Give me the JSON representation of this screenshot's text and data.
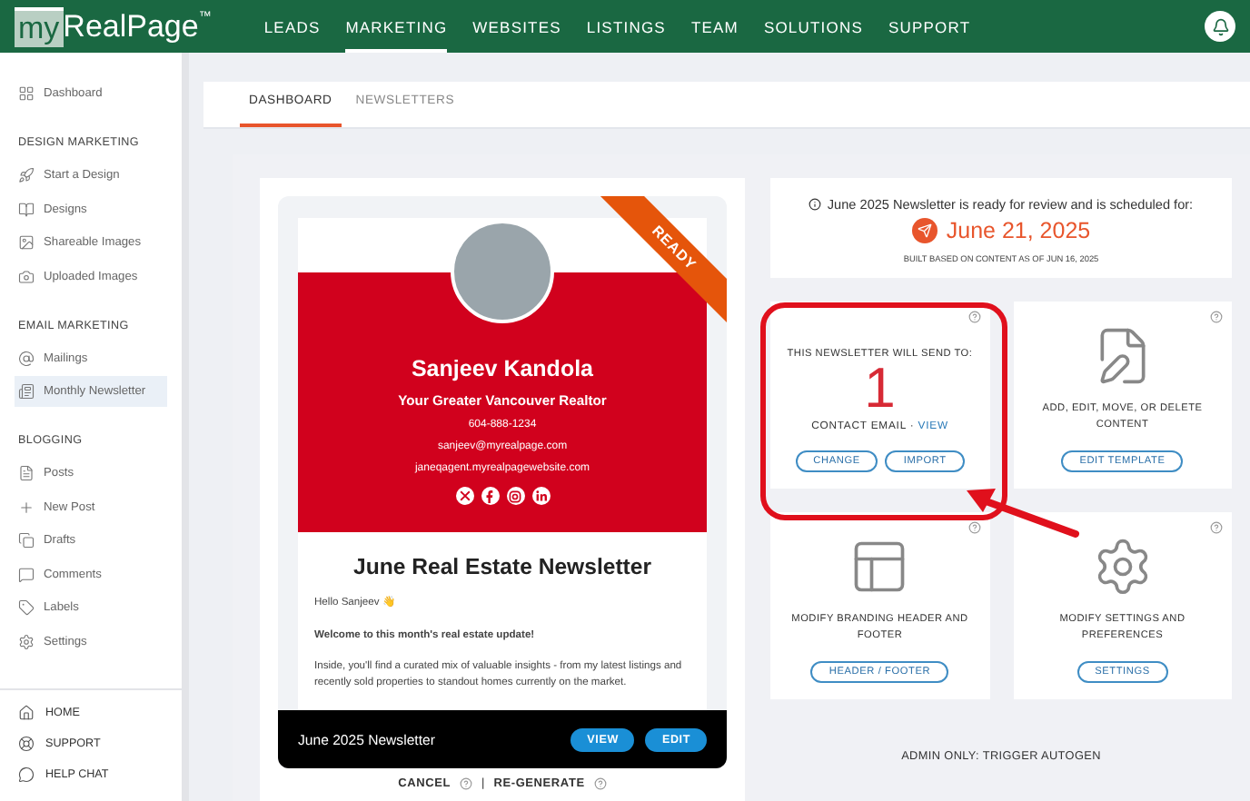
{
  "header": {
    "logo_prefix": "my",
    "logo_main": "RealPage",
    "logo_mark": "™",
    "nav": [
      {
        "label": "LEADS",
        "selected": false
      },
      {
        "label": "MARKETING",
        "selected": true
      },
      {
        "label": "WEBSITES",
        "selected": false
      },
      {
        "label": "LISTINGS",
        "selected": false
      },
      {
        "label": "TEAM",
        "selected": false
      },
      {
        "label": "SOLUTIONS",
        "selected": false
      },
      {
        "label": "SUPPORT",
        "selected": false
      }
    ]
  },
  "sidebar": {
    "sections": [
      {
        "items": [
          {
            "label": "Dashboard",
            "selected": false
          }
        ]
      },
      {
        "heading": "DESIGN MARKETING",
        "items": [
          {
            "label": "Start a Design",
            "selected": false
          },
          {
            "label": "Designs",
            "selected": false
          },
          {
            "label": "Shareable Images",
            "selected": false
          },
          {
            "label": "Uploaded Images",
            "selected": false
          }
        ]
      },
      {
        "heading": "EMAIL MARKETING",
        "items": [
          {
            "label": "Mailings",
            "selected": false
          },
          {
            "label": "Monthly Newsletter",
            "selected": true
          }
        ]
      },
      {
        "heading": "BLOGGING",
        "items": [
          {
            "label": "Posts",
            "selected": false
          },
          {
            "label": "New Post",
            "selected": false
          },
          {
            "label": "Drafts",
            "selected": false
          },
          {
            "label": "Comments",
            "selected": false
          },
          {
            "label": "Labels",
            "selected": false
          },
          {
            "label": "Settings",
            "selected": false
          }
        ]
      }
    ],
    "bottom_links": [
      "HOME",
      "SUPPORT",
      "HELP CHAT"
    ]
  },
  "tabs": [
    {
      "label": "DASHBOARD",
      "selected": true
    },
    {
      "label": "NEWSLETTERS",
      "selected": false
    }
  ],
  "preview": {
    "ribbon": "READY",
    "agent_name": "Sanjeev Kandola",
    "tagline": "Your Greater Vancouver Realtor",
    "phone": "604-888-1234",
    "email": "sanjeev@myrealpage.com",
    "website": "janeqagent.myrealpagewebsite.com",
    "newsletter_title": "June Real Estate Newsletter",
    "greeting": "Hello Sanjeev 👋",
    "intro_heading": "Welcome to this month's real estate update!",
    "body": "Inside, you'll find a curated mix of valuable insights - from my latest listings and recently sold properties to standout homes currently on the market.",
    "bar_title": "June 2025 Newsletter",
    "bar_buttons": [
      "VIEW",
      "EDIT"
    ],
    "actions": [
      "CANCEL",
      "RE-GENERATE"
    ],
    "action_separator": "|"
  },
  "schedule": {
    "notice": "June 2025 Newsletter is ready for review and is scheduled for:",
    "date": "June 21, 2025",
    "built": "BUILT BASED ON CONTENT AS OF JUN 16, 2025"
  },
  "cards": [
    {
      "kind": "recipients",
      "label": "THIS NEWSLETTER WILL SEND TO:",
      "count": "1",
      "detail": "CONTACT EMAIL",
      "separator": "·",
      "link": "VIEW",
      "buttons": [
        "CHANGE",
        "IMPORT"
      ]
    },
    {
      "kind": "template",
      "label": "ADD, EDIT, MOVE, OR DELETE CONTENT",
      "buttons": [
        "EDIT TEMPLATE"
      ]
    },
    {
      "kind": "layout",
      "label": "MODIFY BRANDING HEADER AND FOOTER",
      "buttons": [
        "HEADER / FOOTER"
      ]
    },
    {
      "kind": "settings",
      "label": "MODIFY SETTINGS AND PREFERENCES",
      "buttons": [
        "SETTINGS"
      ]
    }
  ],
  "admin": "ADMIN ONLY: TRIGGER AUTOGEN"
}
